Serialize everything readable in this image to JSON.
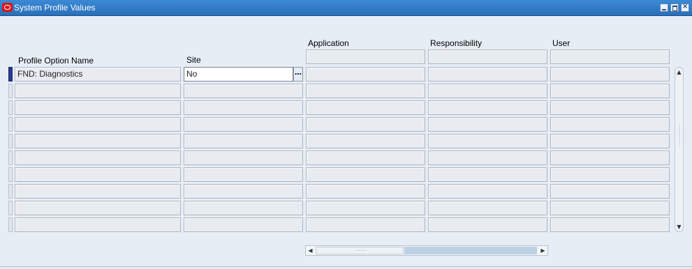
{
  "window": {
    "title": "System Profile Values",
    "accent_color": "#2a6fb9",
    "controls": [
      "minimize-icon",
      "maximize-icon",
      "close-icon"
    ]
  },
  "columns": {
    "profile_option_name": "Profile Option Name",
    "site": "Site",
    "application": "Application",
    "responsibility": "Responsibility",
    "user": "User"
  },
  "rows": [
    {
      "profile_option_name": "FND: Diagnostics",
      "site": "No",
      "application": "",
      "responsibility": "",
      "user": ""
    },
    {
      "profile_option_name": "",
      "site": "",
      "application": "",
      "responsibility": "",
      "user": ""
    },
    {
      "profile_option_name": "",
      "site": "",
      "application": "",
      "responsibility": "",
      "user": ""
    },
    {
      "profile_option_name": "",
      "site": "",
      "application": "",
      "responsibility": "",
      "user": ""
    },
    {
      "profile_option_name": "",
      "site": "",
      "application": "",
      "responsibility": "",
      "user": ""
    },
    {
      "profile_option_name": "",
      "site": "",
      "application": "",
      "responsibility": "",
      "user": ""
    },
    {
      "profile_option_name": "",
      "site": "",
      "application": "",
      "responsibility": "",
      "user": ""
    },
    {
      "profile_option_name": "",
      "site": "",
      "application": "",
      "responsibility": "",
      "user": ""
    },
    {
      "profile_option_name": "",
      "site": "",
      "application": "",
      "responsibility": "",
      "user": ""
    },
    {
      "profile_option_name": "",
      "site": "",
      "application": "",
      "responsibility": "",
      "user": ""
    }
  ],
  "lov_button_label": "…"
}
